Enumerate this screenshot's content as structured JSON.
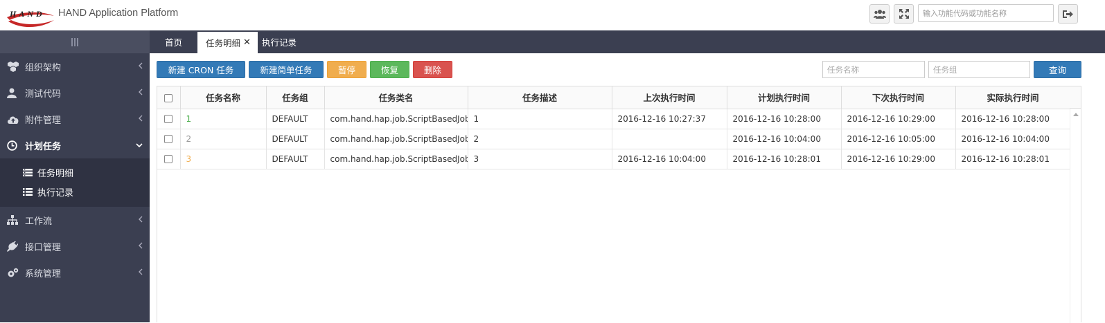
{
  "app": {
    "logo_text": "HAND",
    "title": "HAND Application Platform"
  },
  "header": {
    "search_placeholder": "输入功能代码或功能名称",
    "icons": [
      "users-icon",
      "expand-icon",
      "logout-icon"
    ]
  },
  "sidebar": {
    "toggle_icon": "menu-bars-icon",
    "items": [
      {
        "label": "组织架构",
        "icon": "cubes-icon",
        "expanded": false
      },
      {
        "label": "测试代码",
        "icon": "user-icon",
        "expanded": false
      },
      {
        "label": "附件管理",
        "icon": "cloud-upload-icon",
        "expanded": false
      },
      {
        "label": "计划任务",
        "icon": "clock-icon",
        "expanded": true
      },
      {
        "label": "工作流",
        "icon": "sitemap-icon",
        "expanded": false
      },
      {
        "label": "接口管理",
        "icon": "plug-icon",
        "expanded": false
      },
      {
        "label": "系统管理",
        "icon": "cogs-icon",
        "expanded": false
      }
    ],
    "subitems": [
      {
        "label": "任务明细",
        "icon": "list-alt-icon"
      },
      {
        "label": "执行记录",
        "icon": "list-icon"
      }
    ]
  },
  "tabs": [
    {
      "label": "首页",
      "active": false
    },
    {
      "label": "任务明细",
      "active": true,
      "closable": true,
      "close": "✕"
    },
    {
      "label": "执行记录",
      "active": false
    }
  ],
  "toolbar": {
    "new_cron": "新建 CRON 任务",
    "new_simple": "新建简单任务",
    "pause": "暂停",
    "resume": "恢复",
    "delete": "删除",
    "filter_name_placeholder": "任务名称",
    "filter_group_placeholder": "任务组",
    "query": "查询"
  },
  "colors": {
    "sidebar_bg": "#3b3f51",
    "primary": "#337ab7",
    "warning": "#f0ad4e",
    "success": "#5cb85c",
    "danger": "#d9534f",
    "name_green": "#4cae4c",
    "name_gray": "#999999",
    "name_orange": "#f0ad4e"
  },
  "table": {
    "columns": [
      "任务名称",
      "任务组",
      "任务类名",
      "任务描述",
      "上次执行时间",
      "计划执行时间",
      "下次执行时间",
      "实际执行时间"
    ],
    "rows": [
      {
        "name": "1",
        "name_color": "#4cae4c",
        "group": "DEFAULT",
        "class": "com.hand.hap.job.ScriptBasedJob",
        "desc": "1",
        "last": "2016-12-16 10:27:37",
        "planned": "2016-12-16 10:28:00",
        "next": "2016-12-16 10:29:00",
        "actual": "2016-12-16 10:28:00"
      },
      {
        "name": "2",
        "name_color": "#999999",
        "group": "DEFAULT",
        "class": "com.hand.hap.job.ScriptBasedJob",
        "desc": "2",
        "last": "",
        "planned": "2016-12-16 10:04:00",
        "next": "2016-12-16 10:05:00",
        "actual": "2016-12-16 10:04:00"
      },
      {
        "name": "3",
        "name_color": "#f0ad4e",
        "group": "DEFAULT",
        "class": "com.hand.hap.job.ScriptBasedJob",
        "desc": "3",
        "last": "2016-12-16 10:04:00",
        "planned": "2016-12-16 10:28:01",
        "next": "2016-12-16 10:29:00",
        "actual": "2016-12-16 10:28:01"
      }
    ]
  }
}
